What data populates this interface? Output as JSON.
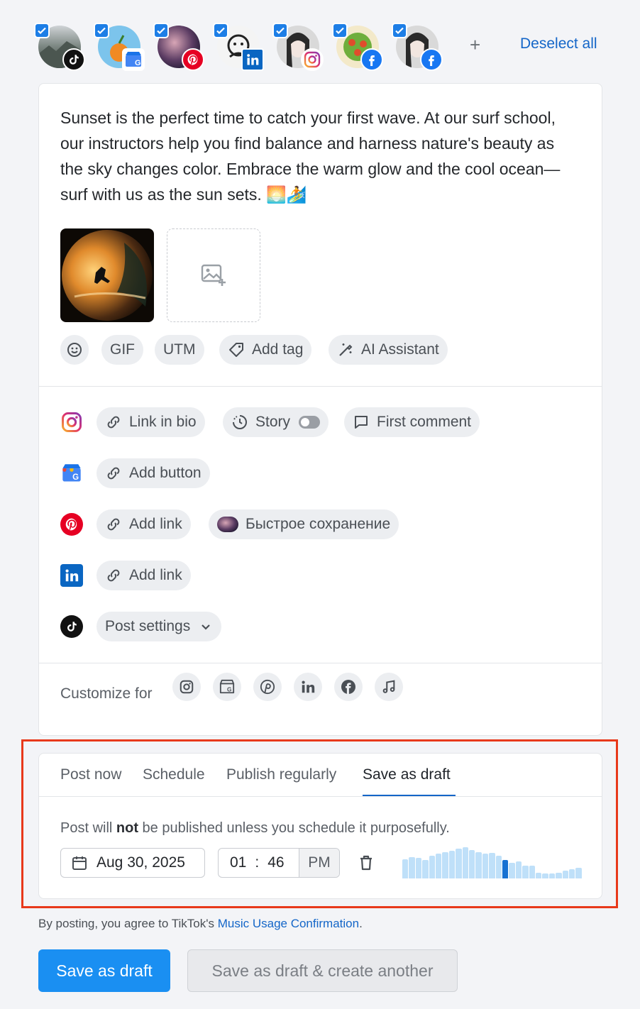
{
  "accounts": [
    {
      "network": "tiktok",
      "icon": "tiktok-icon",
      "selected": true
    },
    {
      "network": "google-business",
      "icon": "google-business-icon",
      "selected": true
    },
    {
      "network": "pinterest",
      "icon": "pinterest-icon",
      "selected": true
    },
    {
      "network": "linkedin",
      "icon": "linkedin-icon",
      "selected": true
    },
    {
      "network": "instagram",
      "icon": "instagram-icon",
      "selected": true
    },
    {
      "network": "facebook",
      "icon": "facebook-icon",
      "selected": true
    },
    {
      "network": "facebook",
      "icon": "facebook-icon",
      "selected": true
    }
  ],
  "header": {
    "add_symbol": "+",
    "deselect_label": "Deselect all"
  },
  "post": {
    "text": "Sunset is the perfect time to catch your first wave. At our surf school, our instructors help you find balance and harness nature's beauty as the sky changes color. Embrace the warm glow and the cool ocean—surf with us as the sun sets. 🌅🏄"
  },
  "tools": {
    "emoji_icon": "emoji-icon",
    "gif": "GIF",
    "utm": "UTM",
    "add_tag": "Add tag",
    "ai": "AI Assistant"
  },
  "networks": {
    "instagram": {
      "link_in_bio": "Link in bio",
      "story": "Story",
      "story_on": false,
      "first_comment": "First comment"
    },
    "google": {
      "add_button": "Add button"
    },
    "pinterest": {
      "add_link": "Add link",
      "board": "Быстрое сохранение"
    },
    "linkedin": {
      "add_link": "Add link"
    },
    "tiktok": {
      "post_settings": "Post settings"
    }
  },
  "customize": {
    "label": "Customize for",
    "icons": [
      "instagram-icon",
      "google-business-icon",
      "pinterest-icon",
      "linkedin-icon",
      "facebook-icon",
      "tiktok-music-icon"
    ]
  },
  "schedule": {
    "tabs": [
      "Post now",
      "Schedule",
      "Publish regularly",
      "Save as draft"
    ],
    "active_tab": "Save as draft",
    "note_pre": "Post will ",
    "note_bold": "not",
    "note_post": " be published unless you schedule it purposefully.",
    "date": "Aug 30, 2025",
    "hour": "01",
    "sep": ":",
    "minute": "46",
    "ampm": "PM",
    "activity_levels": [
      0.62,
      0.68,
      0.65,
      0.6,
      0.72,
      0.8,
      0.85,
      0.88,
      0.95,
      1.0,
      0.92,
      0.85,
      0.8,
      0.82,
      0.72,
      0.6,
      0.5,
      0.55,
      0.42,
      0.4,
      0.18,
      0.15,
      0.15,
      0.18,
      0.25,
      0.3,
      0.35
    ],
    "current_slot": 15
  },
  "footer": {
    "agree_pre": "By posting, you agree to TikTok's ",
    "agree_link": "Music Usage Confirmation",
    "agree_post": "."
  },
  "buttons": {
    "primary": "Save as draft",
    "secondary": "Save as draft & create another"
  },
  "colors": {
    "accent": "#1466c8",
    "primary_button": "#1a8ff2",
    "frame": "#e8391b"
  }
}
